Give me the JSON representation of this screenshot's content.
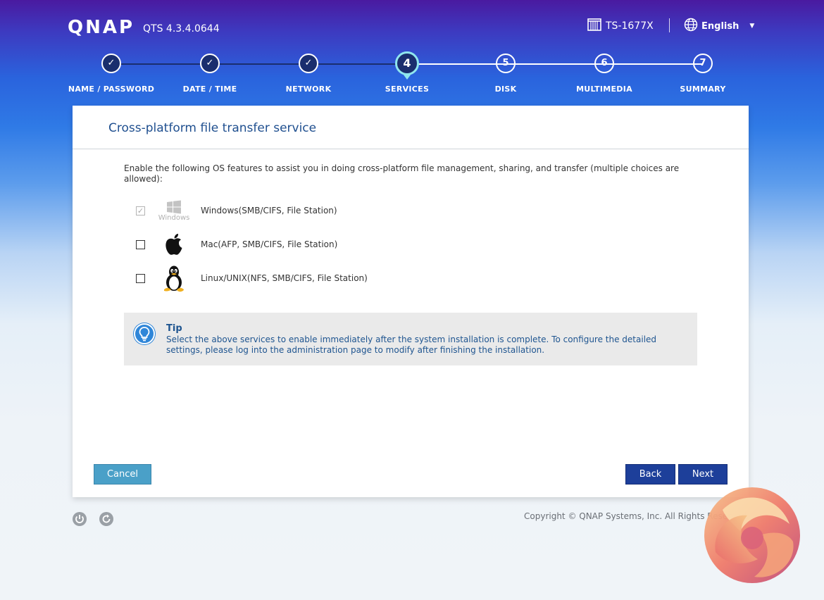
{
  "header": {
    "brand": "QNAP",
    "version": "QTS 4.3.4.0644",
    "model": "TS-1677X",
    "language": "English"
  },
  "steps": [
    {
      "number": "1",
      "label": "NAME / PASSWORD",
      "state": "done"
    },
    {
      "number": "2",
      "label": "DATE / TIME",
      "state": "done"
    },
    {
      "number": "3",
      "label": "NETWORK",
      "state": "done"
    },
    {
      "number": "4",
      "label": "SERVICES",
      "state": "active"
    },
    {
      "number": "5",
      "label": "DISK",
      "state": "todo"
    },
    {
      "number": "6",
      "label": "MULTIMEDIA",
      "state": "todo"
    },
    {
      "number": "7",
      "label": "SUMMARY",
      "state": "todo"
    }
  ],
  "panel": {
    "title": "Cross-platform file transfer service",
    "intro": "Enable the following OS features to assist you in doing cross-platform file management, sharing, and transfer (multiple choices are allowed):",
    "options": [
      {
        "label": "Windows(SMB/CIFS, File Station)",
        "icon": "windows-icon",
        "icon_caption": "Windows",
        "checked": true,
        "disabled": true
      },
      {
        "label": "Mac(AFP, SMB/CIFS, File Station)",
        "icon": "apple-icon",
        "checked": false,
        "disabled": false
      },
      {
        "label": "Linux/UNIX(NFS, SMB/CIFS, File Station)",
        "icon": "tux-icon",
        "checked": false,
        "disabled": false
      }
    ],
    "tip": {
      "title": "Tip",
      "text": "Select the above services to enable immediately after the system installation is complete. To configure the detailed settings, please log into the administration page to modify after finishing the installation."
    },
    "buttons": {
      "cancel": "Cancel",
      "back": "Back",
      "next": "Next"
    }
  },
  "footer": {
    "copyright": "Copyright © QNAP Systems, Inc. All Rights Reserved."
  },
  "colors": {
    "accent": "#1d3f9a",
    "title": "#1f4f8f",
    "cancel": "#4aa0c8",
    "step_active_ring": "#8fe6ee"
  }
}
